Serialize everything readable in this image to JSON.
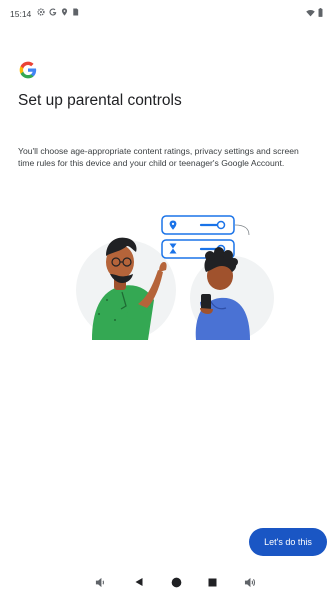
{
  "status_bar": {
    "time": "15:14",
    "left_icons": [
      "settings-gear-icon",
      "google-g-icon",
      "location-icon",
      "sim-card-icon"
    ],
    "right_icons": [
      "wifi-icon",
      "battery-icon"
    ]
  },
  "header": {
    "logo": "google-g-logo",
    "title": "Set up parental controls"
  },
  "main": {
    "description": "You'll choose age-appropriate content ratings, privacy settings and screen time rules for this device and your child or teenager's Google Account.",
    "illustration": "parent-and-child-illustration"
  },
  "actions": {
    "primary_label": "Let's do this"
  },
  "nav_bar": {
    "items": [
      "volume-down-icon",
      "back-icon",
      "home-icon",
      "overview-icon",
      "volume-up-icon"
    ]
  },
  "colors": {
    "button": "#1a56c4",
    "text": "#202124",
    "body_text": "#3c4043",
    "parent_shirt": "#34a853",
    "child_hoodie": "#4a72d4",
    "card_blue": "#1a73e8"
  }
}
